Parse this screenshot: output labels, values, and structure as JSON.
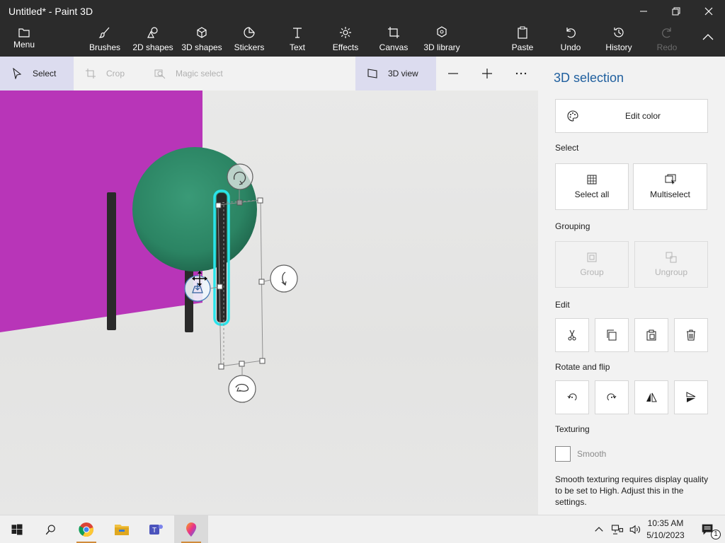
{
  "window": {
    "title": "Untitled* - Paint 3D"
  },
  "ribbon": {
    "menu": "Menu",
    "brushes": "Brushes",
    "shapes2d": "2D shapes",
    "shapes3d": "3D shapes",
    "stickers": "Stickers",
    "text": "Text",
    "effects": "Effects",
    "canvas": "Canvas",
    "library3d": "3D library",
    "paste": "Paste",
    "undo": "Undo",
    "history": "History",
    "redo": "Redo"
  },
  "toolbar": {
    "select": "Select",
    "crop": "Crop",
    "magic_select": "Magic select",
    "view3d": "3D view"
  },
  "panel": {
    "title": "3D selection",
    "edit_color": "Edit color",
    "select_heading": "Select",
    "select_all": "Select all",
    "multiselect": "Multiselect",
    "grouping_heading": "Grouping",
    "group": "Group",
    "ungroup": "Ungroup",
    "edit_heading": "Edit",
    "rotate_heading": "Rotate and flip",
    "texturing_heading": "Texturing",
    "smooth": "Smooth",
    "smooth_checked": false,
    "note": "Smooth texturing requires display quality to be set to High. Adjust this in the settings."
  },
  "taskbar": {
    "time": "10:35 AM",
    "date": "5/10/2023",
    "notification_count": "1"
  },
  "colors": {
    "chrome": "#2b2b2b",
    "accent": "#1f5f9e",
    "magenta": "#b835b8",
    "sphere": "#2e8a68",
    "selection": "#29e3ea"
  }
}
